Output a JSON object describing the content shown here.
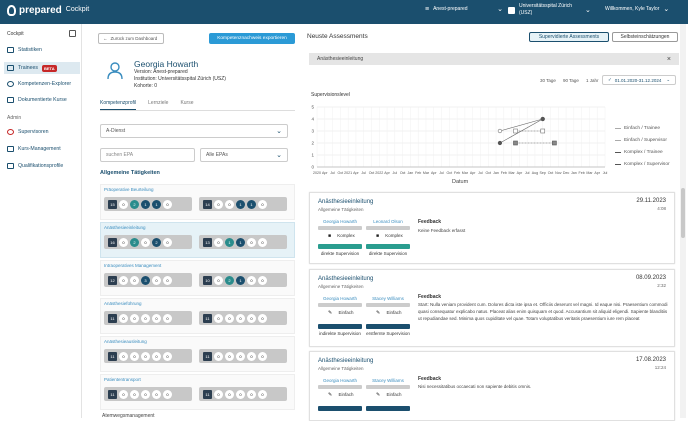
{
  "topbar": {
    "logo_main": "prepared",
    "logo_sub": "Cockpit",
    "course": "Anest-prepared",
    "institution_line1": "Universitätsspital Zürich",
    "institution_line2": "(USZ)",
    "user": "Willkommen, Kyle Taylor"
  },
  "sidebar": {
    "header": "Cockpit",
    "items": [
      {
        "label": "Statistiken"
      },
      {
        "label": "Trainees",
        "badge": "BETA"
      },
      {
        "label": "Kompetenzen-Explorer"
      },
      {
        "label": "Dokumentierte Kurse"
      }
    ],
    "admin_label": "Admin",
    "admin_items": [
      {
        "label": "Supervisoren"
      },
      {
        "label": "Kurs-Management"
      },
      {
        "label": "Qualifikationsprofile"
      }
    ]
  },
  "left": {
    "back_label": "Zurück zum Dashboard",
    "export_label": "Kompetenznachweis exportieren",
    "name": "Georgia Howarth",
    "version": "Version: Anest-prepared",
    "institution": "Institution: Universitätsspital Zürich (USZ)",
    "kohorte": "Kohorte: 0",
    "tabs": [
      "Kompetenzprofil",
      "Lernziele",
      "Kurse"
    ],
    "dienst": "A-Dienst",
    "search_placeholder": "suchen EPA",
    "epa_filter": "Alle EPAs",
    "section_title": "Allgemeine Tätigkeiten",
    "skills": [
      {
        "title": "Präoperative Beurteilung",
        "a": [
          "15",
          "0",
          "2",
          "1",
          "1",
          "0"
        ],
        "b": [
          "14",
          "0",
          "0",
          "1",
          "1",
          "0"
        ]
      },
      {
        "title": "Anästhesieeinleitung",
        "a": [
          "16",
          "0",
          "2",
          "0",
          "2",
          "0"
        ],
        "b": [
          "13",
          "0",
          "1",
          "1",
          "0",
          "0"
        ]
      },
      {
        "title": "Intraoperatives Management",
        "a": [
          "12",
          "0",
          "0",
          "3",
          "0",
          "0"
        ],
        "b": [
          "10",
          "0",
          "2",
          "1",
          "0",
          "0"
        ]
      },
      {
        "title": "Anästhesieführung",
        "a": [
          "11",
          "0",
          "0",
          "0",
          "0",
          "0"
        ],
        "b": [
          "11",
          "0",
          "0",
          "0",
          "0",
          "0"
        ]
      },
      {
        "title": "Anästhesieausleitung",
        "a": [
          "11",
          "0",
          "0",
          "0",
          "0",
          "0"
        ],
        "b": [
          "11",
          "0",
          "0",
          "0",
          "0",
          "0"
        ]
      },
      {
        "title": "Patiententransport",
        "a": [
          "11",
          "0",
          "0",
          "0",
          "0",
          "0"
        ],
        "b": [
          "11",
          "0",
          "0",
          "0",
          "0",
          "0"
        ]
      }
    ],
    "next_section": "Atemwegsmanagement"
  },
  "right": {
    "title": "Neuste Assessments",
    "tab_supervised": "Supervidierte Assessments",
    "tab_self": "Selbsteinschätzungen",
    "selected_epa": "Anästhesieeinleitung",
    "ranges": [
      "30 Tage",
      "90 Tage",
      "1 Jahr"
    ],
    "date_range": "01.01.2020-31.12.2024",
    "chart_ylabel": "Supervisionslevel",
    "chart_xlabel": "Datum",
    "legend": [
      "Einfach / Trainee",
      "Einfach / Supervisor",
      "Komplex / Trainee",
      "Komplex / Supervisor"
    ]
  },
  "chart_data": {
    "type": "scatter",
    "title": "",
    "ylabel": "Supervisionslevel",
    "xlabel": "Datum",
    "ylim": [
      0,
      5
    ],
    "yticks": [
      "0",
      "1",
      "2",
      "3",
      "4",
      "5"
    ],
    "xticks": [
      "2020",
      "Apr",
      "Jul",
      "Oct",
      "2021",
      "Apr",
      "Jul",
      "Oct",
      "2022",
      "Apr",
      "Jul",
      "Oct",
      "Jan",
      "Feb",
      "Mar",
      "Apr",
      "Jul",
      "Oct",
      "Feb",
      "Mar",
      "Apr",
      "Jul",
      "Oct",
      "Jan",
      "Feb",
      "Mar",
      "Apr",
      "Jul",
      "Aug",
      "Sep",
      "Oct",
      "Nov",
      "Dec",
      "Jan",
      "Feb",
      "Mar",
      "Apr",
      "Jul"
    ],
    "series": [
      {
        "name": "Einfach / Trainee",
        "points": [
          {
            "xi": 23.5,
            "y": 3
          },
          {
            "xi": 29,
            "y": 4
          }
        ]
      },
      {
        "name": "Einfach / Supervisor",
        "points": [
          {
            "xi": 25.5,
            "y": 3
          },
          {
            "xi": 29,
            "y": 3
          }
        ]
      },
      {
        "name": "Komplex / Trainee",
        "points": [
          {
            "xi": 23.5,
            "y": 2
          },
          {
            "xi": 29,
            "y": 4
          }
        ]
      },
      {
        "name": "Komplex / Supervisor",
        "points": [
          {
            "xi": 25.5,
            "y": 2
          },
          {
            "xi": 30.5,
            "y": 2
          }
        ]
      }
    ],
    "grid": true,
    "legend_position": "right"
  },
  "cards": [
    {
      "title": "Anästhesieeinleitung",
      "subtitle": "Allgemeine Tätigkeiten",
      "date": "29.11.2023",
      "time": "4:08",
      "people": [
        {
          "name": "Georgia Howarth",
          "case": "Komplex",
          "level": "direkte Supervision",
          "color": "#2a9d8f"
        },
        {
          "name": "Leonard Olson",
          "case": "Komplex",
          "level": "direkte Supervision",
          "color": "#2a9d8f"
        }
      ],
      "feedback_title": "Feedback",
      "feedback": "Keine Feedback erfasst"
    },
    {
      "title": "Anästhesieeinleitung",
      "subtitle": "Allgemeine Tätigkeiten",
      "date": "08.09.2023",
      "time": "2:32",
      "people": [
        {
          "name": "Georgia Howarth",
          "case": "Einfach",
          "level": "indirekte Supervision",
          "color": "#1b4f6e"
        },
        {
          "name": "Stacey Williams",
          "case": "Einfach",
          "level": "erstfernte Supervision",
          "color": "#1b4f6e"
        }
      ],
      "feedback_title": "Feedback",
      "feedback": "Start: Nulla veniam provident cum. Dolores dicta iste ipsa et. Officiis deserunt vel magni. Id eaque nisi. Praesentium commodi quasi consequatur explicabo natus. Placeat alias enim quisquam et quod. Accusantium sit aliquid eligendi. Sapiente blanditiis ut repudiandae sed. Minima quos cupiditate vel quae. Totam voluptatibus veritatis praesentium iure rem placeat"
    },
    {
      "title": "Anästhesieeinleitung",
      "subtitle": "Allgemeine Tätigkeiten",
      "date": "17.08.2023",
      "time": "12:24",
      "people": [
        {
          "name": "Georgia Howarth",
          "case": "Einfach",
          "level": "",
          "color": "#1b4f6e"
        },
        {
          "name": "Stacey Williams",
          "case": "Einfach",
          "level": "",
          "color": "#1b4f6e"
        }
      ],
      "feedback_title": "Feedback",
      "feedback": "Nisi necessitatibus occaecati non sapiente debitis omnis."
    }
  ]
}
